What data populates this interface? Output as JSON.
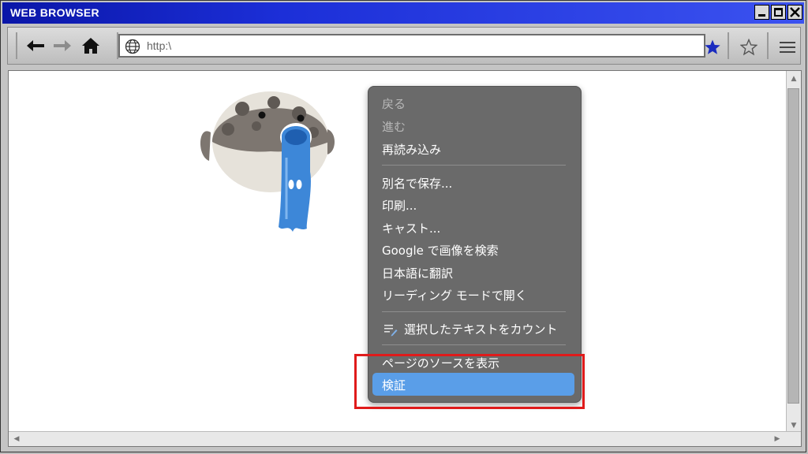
{
  "window": {
    "title": "WEB BROWSER"
  },
  "address_bar": {
    "value": "http:\\",
    "placeholder": ""
  },
  "context_menu": {
    "items": [
      {
        "label": "戻る",
        "disabled": true
      },
      {
        "label": "進む",
        "disabled": true
      },
      {
        "label": "再読み込み",
        "disabled": false
      },
      {
        "label": "別名で保存...",
        "disabled": false
      },
      {
        "label": "印刷...",
        "disabled": false
      },
      {
        "label": "キャスト...",
        "disabled": false
      },
      {
        "label": "Google で画像を検索",
        "disabled": false
      },
      {
        "label": "日本語に翻訳",
        "disabled": false
      },
      {
        "label": "リーディング モードで開く",
        "disabled": false
      },
      {
        "label": "選択したテキストをカウント",
        "disabled": false,
        "icon": "text-count-icon"
      },
      {
        "label": "ページのソースを表示",
        "disabled": false
      },
      {
        "label": "検証",
        "disabled": false,
        "selected": true
      }
    ]
  },
  "colors": {
    "titlebar": "#1c2fd8",
    "menu_bg": "#6a6a6a",
    "menu_highlight": "#5a9ee8",
    "annotation_box": "#e01b1b",
    "bookmark_star": "#1a2bbf"
  },
  "icons": [
    "back-arrow-icon",
    "forward-arrow-icon",
    "home-icon",
    "globe-icon",
    "bookmark-star-filled-icon",
    "star-outline-icon",
    "hamburger-menu-icon",
    "minimize-icon",
    "maximize-icon",
    "close-icon"
  ]
}
